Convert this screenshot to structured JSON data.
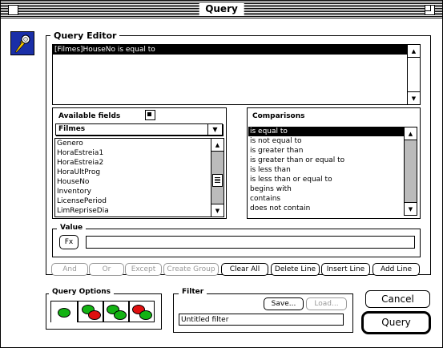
{
  "window": {
    "title": "Query"
  },
  "query_editor": {
    "label": "Query Editor",
    "expression": "[Filmes]HouseNo is equal to"
  },
  "available_fields": {
    "label": "Available fields",
    "table_selected": "Filmes",
    "items": [
      "Genero",
      "HoraEstreia1",
      "HoraEstreia2",
      "HoraUltProg",
      "HouseNo",
      "Inventory",
      "LicensePeriod",
      "LimRepriseDia"
    ]
  },
  "comparisons": {
    "label": "Comparisons",
    "selected_index": 0,
    "items": [
      "is equal to",
      "is not equal to",
      "is greater than",
      "is greater than or equal to",
      "is less than",
      "is less than or equal to",
      "begins with",
      "contains",
      "does not contain"
    ]
  },
  "value": {
    "label": "Value",
    "fx_label": "Fx",
    "current": ""
  },
  "line_buttons": {
    "and": "And",
    "or": "Or",
    "except": "Except",
    "create_group": "Create Group",
    "clear_all": "Clear All",
    "delete_line": "Delete Line",
    "insert_line": "Insert Line",
    "add_line": "Add Line"
  },
  "query_options": {
    "label": "Query Options"
  },
  "filter": {
    "label": "Filter",
    "save_label": "Save...",
    "load_label": "Load...",
    "name": "Untitled filter"
  },
  "actions": {
    "cancel": "Cancel",
    "query": "Query"
  },
  "colors": {
    "green": "#13b313",
    "red": "#e01010"
  }
}
